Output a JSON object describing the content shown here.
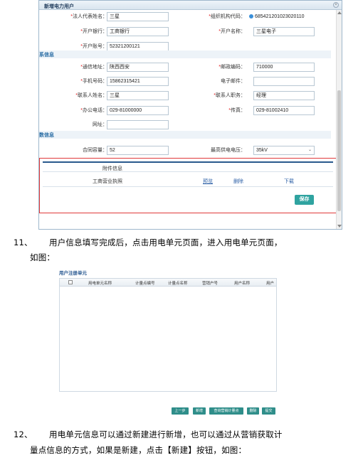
{
  "dialog": {
    "title": "新增电力用户",
    "fields": {
      "legal_rep": {
        "label": "*法人代表姓名：",
        "value": "三星"
      },
      "org_code": {
        "label": "*组织机构代码：",
        "value": "685421201023020110"
      },
      "bank": {
        "label": "*开户银行：",
        "value": "工商银行"
      },
      "account_name": {
        "label": "*开户名称：",
        "value": "三星电子"
      },
      "account_no": {
        "label": "*开户账号：",
        "value": "52321200121"
      },
      "address": {
        "label": "*通信地址：",
        "value": "陕西西安"
      },
      "postcode": {
        "label": "*邮政编码：",
        "value": "710000"
      },
      "mobile": {
        "label": "*手机号码：",
        "value": "15862315421"
      },
      "email": {
        "label": "电子邮件：",
        "value": ""
      },
      "contact_name": {
        "label": "*联系人姓名：",
        "value": "三星"
      },
      "contact_title": {
        "label": "*联系人职务：",
        "value": "经理"
      },
      "office_phone": {
        "label": "*办公电话：",
        "value": "029-81000000"
      },
      "fax": {
        "label": "*传真：",
        "value": "029-81002410"
      },
      "website": {
        "label": "网址：",
        "value": ""
      },
      "capacity": {
        "label": "合同容量：",
        "value": "52"
      },
      "voltage": {
        "label": "最高供电电压：",
        "value": "35kV"
      }
    },
    "sections": {
      "contact": "系信息",
      "params": "数信息"
    },
    "attachments": {
      "header": "附件信息",
      "item_name": "工商营业执照",
      "preview": "预览",
      "delete": "删除",
      "download": "下载"
    },
    "save_label": "保存"
  },
  "step11": {
    "number": "11、",
    "line1": "用户信息填写完成后，点击用电单元页面，进入用电单元页面，",
    "line2": "如图："
  },
  "shot2": {
    "title": "用户注册单元",
    "columns": [
      "用电单元名称",
      "计量点编号",
      "计量点名称",
      "营销户号",
      "用户名称",
      "用户"
    ],
    "buttons": [
      "上一步",
      "新增",
      "查询营销计量点",
      "删除",
      "提交"
    ]
  },
  "step12": {
    "number": "12、",
    "line1": "用电单元信息可以通过新建进行新增，也可以通过从营销获取计",
    "line2": "量点信息的方式，如果是新建，点击【新建】按钮，如图："
  }
}
